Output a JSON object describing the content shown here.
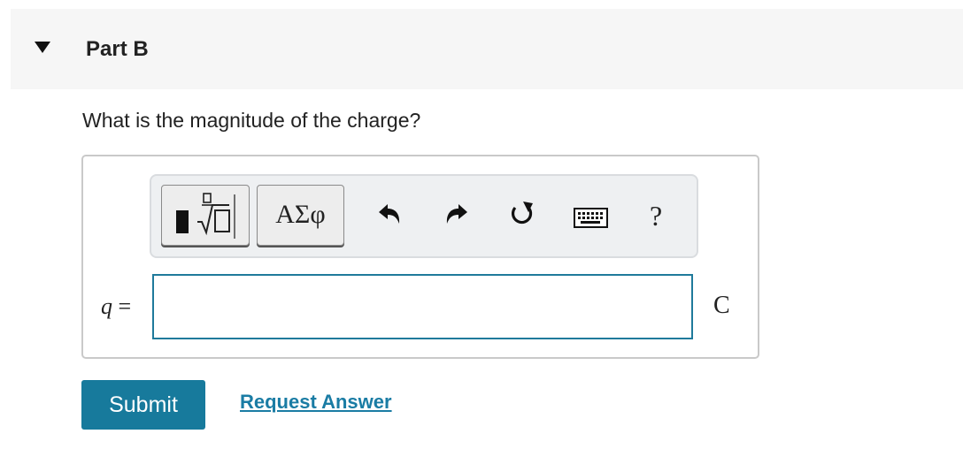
{
  "part": {
    "title": "Part B",
    "toggle_icon": "caret-down-icon"
  },
  "question": {
    "text": "What is the magnitude of the charge?"
  },
  "toolbar": {
    "templates_icon": "templates-icon",
    "symbols_label": "ΑΣφ",
    "undo_icon": "undo-icon",
    "redo_icon": "redo-icon",
    "reset_icon": "reset-icon",
    "keyboard_icon": "keyboard-icon",
    "help_label": "?"
  },
  "equation": {
    "variable": "q",
    "equals": "="
  },
  "answer": {
    "value": "",
    "placeholder": ""
  },
  "unit": {
    "label": "C"
  },
  "actions": {
    "submit_label": "Submit",
    "request_answer_label": "Request Answer"
  },
  "colors": {
    "accent": "#177a9c",
    "link": "#1a7ca4",
    "input_border": "#1f7a9b"
  }
}
